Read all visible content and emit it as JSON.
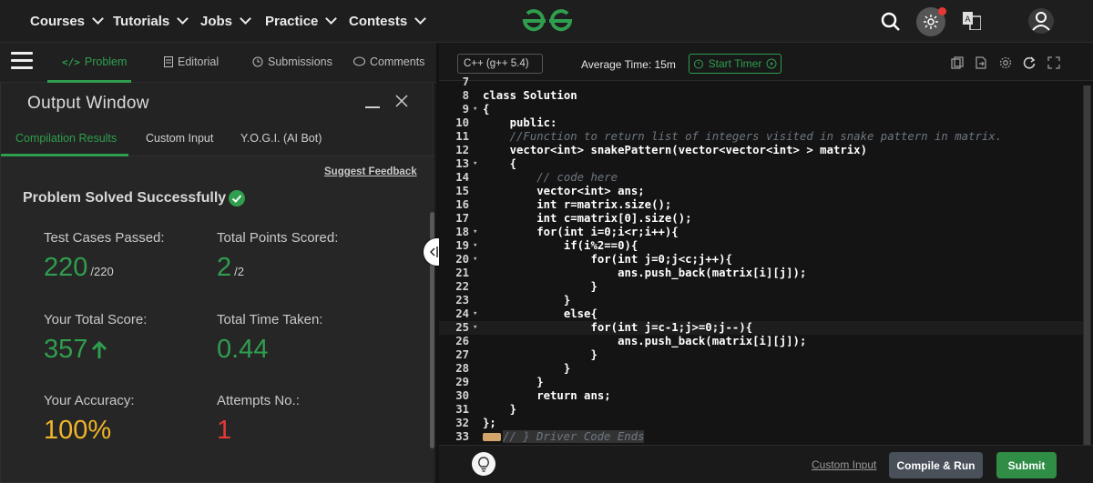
{
  "nav": {
    "items": [
      "Courses",
      "Tutorials",
      "Jobs",
      "Practice",
      "Contests"
    ]
  },
  "colors": {
    "accent": "#2f9e4e",
    "yellow": "#f0b429",
    "red": "#e53935"
  },
  "problem_tabs": {
    "problem": "Problem",
    "editorial": "Editorial",
    "submissions": "Submissions",
    "comments": "Comments"
  },
  "output": {
    "title": "Output Window",
    "tabs": {
      "compilation": "Compilation Results",
      "custom": "Custom Input",
      "yogi": "Y.O.G.I. (AI Bot)"
    },
    "feedback": "Suggest Feedback",
    "status": "Problem Solved Successfully",
    "test_cases_label": "Test Cases Passed:",
    "test_cases_value": "220",
    "test_cases_total": "/220",
    "points_label": "Total Points Scored:",
    "points_value": "2",
    "points_total": "/2",
    "score_label": "Your Total Score:",
    "score_value": "357",
    "time_label": "Total Time Taken:",
    "time_value": "0.44",
    "accuracy_label": "Your Accuracy:",
    "accuracy_value": "100%",
    "attempts_label": "Attempts No.:",
    "attempts_value": "1"
  },
  "editor": {
    "language": "C++ (g++ 5.4)",
    "avg_time": "Average Time: 15m",
    "timer": "Start Timer",
    "custom_input": "Custom Input",
    "compile": "Compile & Run",
    "submit": "Submit",
    "code": [
      {
        "n": "7",
        "t": "",
        "fold": false
      },
      {
        "n": "8",
        "t": "class Solution",
        "fold": false
      },
      {
        "n": "9",
        "t": "{",
        "fold": true
      },
      {
        "n": "10",
        "t": "    public:",
        "fold": false
      },
      {
        "n": "11",
        "t": "    //Function to return list of integers visited in snake pattern in matrix.",
        "fold": false,
        "comment": true
      },
      {
        "n": "12",
        "t": "    vector<int> snakePattern(vector<vector<int> > matrix)",
        "fold": false
      },
      {
        "n": "13",
        "t": "    {",
        "fold": true
      },
      {
        "n": "14",
        "t": "        // code here",
        "fold": false,
        "comment": true
      },
      {
        "n": "15",
        "t": "        vector<int> ans;",
        "fold": false
      },
      {
        "n": "16",
        "t": "        int r=matrix.size();",
        "fold": false
      },
      {
        "n": "17",
        "t": "        int c=matrix[0].size();",
        "fold": false
      },
      {
        "n": "18",
        "t": "        for(int i=0;i<r;i++){",
        "fold": true
      },
      {
        "n": "19",
        "t": "            if(i%2==0){",
        "fold": true
      },
      {
        "n": "20",
        "t": "                for(int j=0;j<c;j++){",
        "fold": true
      },
      {
        "n": "21",
        "t": "                    ans.push_back(matrix[i][j]);",
        "fold": false
      },
      {
        "n": "22",
        "t": "                }",
        "fold": false
      },
      {
        "n": "23",
        "t": "            }",
        "fold": false
      },
      {
        "n": "24",
        "t": "            else{",
        "fold": true
      },
      {
        "n": "25",
        "t": "                for(int j=c-1;j>=0;j--){",
        "fold": true,
        "hl": true
      },
      {
        "n": "26",
        "t": "                    ans.push_back(matrix[i][j]);",
        "fold": false
      },
      {
        "n": "27",
        "t": "                }",
        "fold": false
      },
      {
        "n": "28",
        "t": "            }",
        "fold": false
      },
      {
        "n": "29",
        "t": "        }",
        "fold": false
      },
      {
        "n": "30",
        "t": "        return ans;",
        "fold": false
      },
      {
        "n": "31",
        "t": "    }",
        "fold": false
      },
      {
        "n": "32",
        "t": "};",
        "fold": false
      },
      {
        "n": "33",
        "t": "// } Driver Code Ends",
        "fold": false,
        "comment": true,
        "badge": true
      }
    ]
  }
}
